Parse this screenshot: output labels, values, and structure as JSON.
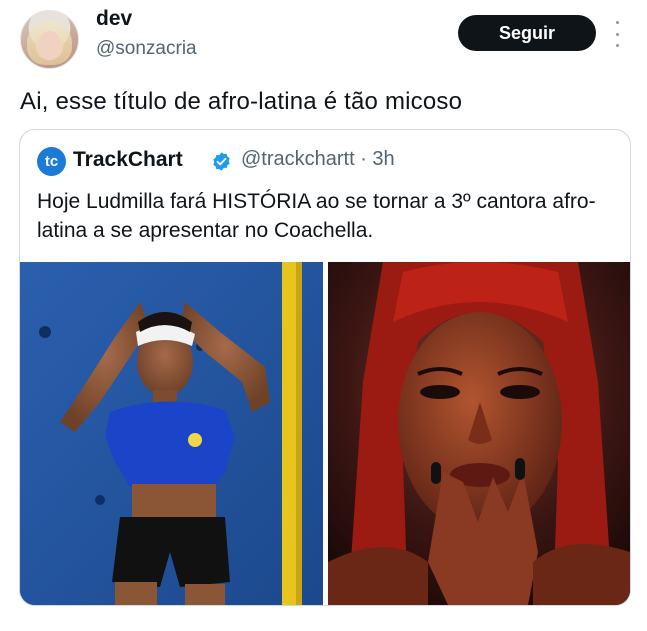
{
  "author": {
    "display_name": "dev",
    "handle": "@sonzacria"
  },
  "follow_button": {
    "label": "Seguir"
  },
  "tweet": {
    "text": "Ai, esse título de afro-latina é tão micoso"
  },
  "quoted_tweet": {
    "logo_text": "tc",
    "display_name": "TrackChart",
    "handle_time": "@trackchartt · 3h",
    "text": "Hoje Ludmilla fará HISTÓRIA ao se tornar a 3º cantora afro-latina a se apresentar no Coachella.",
    "verified_color": "#1d9bf0",
    "logo_color": "#1d7bd8"
  },
  "icons": {
    "more": "more-vertical-icon",
    "verified": "verified-badge-icon"
  }
}
